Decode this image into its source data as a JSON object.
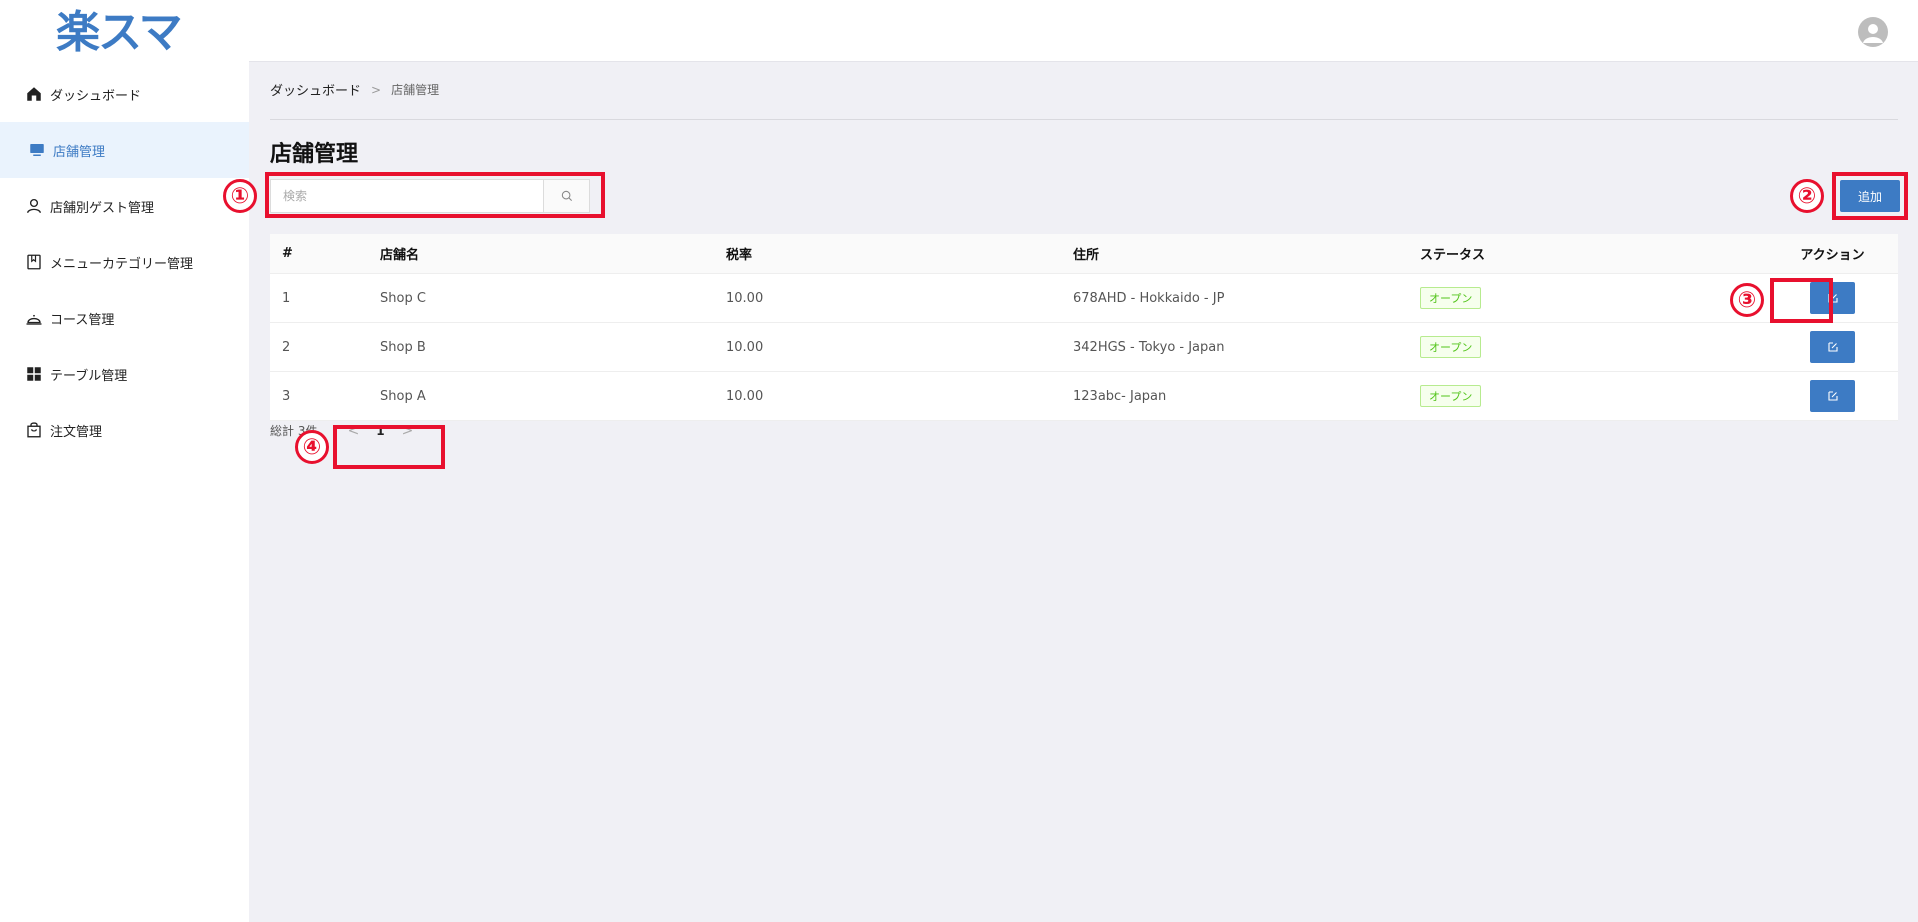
{
  "app": {
    "logo_text": "楽スマ"
  },
  "sidebar": {
    "items": [
      {
        "label": "ダッシュボード",
        "icon": "home-icon",
        "active": false
      },
      {
        "label": "店舗管理",
        "icon": "store-icon",
        "active": true
      },
      {
        "label": "店舗別ゲスト管理",
        "icon": "user-icon",
        "active": false
      },
      {
        "label": "メニューカテゴリー管理",
        "icon": "book-icon",
        "active": false
      },
      {
        "label": "コース管理",
        "icon": "bell-icon",
        "active": false
      },
      {
        "label": "テーブル管理",
        "icon": "grid-icon",
        "active": false
      },
      {
        "label": "注文管理",
        "icon": "bag-icon",
        "active": false
      }
    ]
  },
  "breadcrumb": {
    "home": "ダッシュボード",
    "separator": ">",
    "current": "店舗管理"
  },
  "page": {
    "title": "店舗管理"
  },
  "search": {
    "placeholder": "検索",
    "value": ""
  },
  "toolbar": {
    "add_label": "追加"
  },
  "table": {
    "headers": {
      "num": "#",
      "name": "店舗名",
      "tax": "税率",
      "address": "住所",
      "status": "ステータス",
      "action": "アクション"
    },
    "rows": [
      {
        "num": "1",
        "name": "Shop C",
        "tax": "10.00",
        "address": "678AHD - Hokkaido - JP",
        "status": "オープン"
      },
      {
        "num": "2",
        "name": "Shop B",
        "tax": "10.00",
        "address": "342HGS - Tokyo - Japan",
        "status": "オープン"
      },
      {
        "num": "3",
        "name": "Shop A",
        "tax": "10.00",
        "address": "123abc- Japan",
        "status": "オープン"
      }
    ]
  },
  "pagination": {
    "total": "総計 3件",
    "prev": "<",
    "page": "1",
    "next": ">"
  },
  "annotations": {
    "n1": "①",
    "n2": "②",
    "n3": "③",
    "n4": "④"
  },
  "colors": {
    "accent": "#3d7bc4",
    "annotation": "#e8102e",
    "status_open": "#52c41a"
  }
}
